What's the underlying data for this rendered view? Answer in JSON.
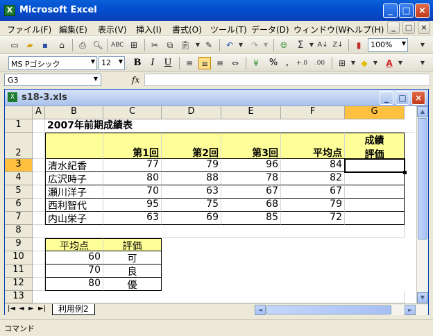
{
  "window": {
    "title": "Microsoft Excel",
    "minimize": "_",
    "maximize": "□",
    "close": "×"
  },
  "menu": [
    "ファイル(F)",
    "編集(E)",
    "表示(V)",
    "挿入(I)",
    "書式(O)",
    "ツール(T)",
    "データ(D)",
    "ウィンドウ(W)",
    "ヘルプ(H)"
  ],
  "toolbar": {
    "zoom": "100%",
    "font_name": "MS Pゴシック",
    "font_size": "12",
    "bold": "B",
    "italic": "I",
    "underline": "U",
    "percent": "%",
    "comma": ",",
    "fx": "fx"
  },
  "formula": {
    "namebox": "G3",
    "content": ""
  },
  "doc": {
    "title": "s18-3.xls"
  },
  "columns": [
    "A",
    "B",
    "C",
    "D",
    "E",
    "F",
    "G"
  ],
  "rows": [
    "1",
    "2",
    "3",
    "4",
    "5",
    "6",
    "7",
    "8",
    "9",
    "10",
    "11",
    "12",
    "13"
  ],
  "sheet": {
    "title": "2007年前期成績表",
    "headers": {
      "c": "第1回",
      "d": "第2回",
      "e": "第3回",
      "f": "平均点",
      "g1": "成績",
      "g2": "評価"
    },
    "students": [
      {
        "name": "清水紀香",
        "c": "77",
        "d": "79",
        "e": "96",
        "f": "84"
      },
      {
        "name": "広沢時子",
        "c": "80",
        "d": "88",
        "e": "78",
        "f": "82"
      },
      {
        "name": "瀬川洋子",
        "c": "70",
        "d": "63",
        "e": "67",
        "f": "67"
      },
      {
        "name": "西利智代",
        "c": "95",
        "d": "75",
        "e": "68",
        "f": "79"
      },
      {
        "name": "内山栄子",
        "c": "63",
        "d": "69",
        "e": "85",
        "f": "72"
      }
    ],
    "lookup_header": {
      "b": "平均点",
      "c": "評価"
    },
    "lookup": [
      {
        "b": "60",
        "c": "可"
      },
      {
        "b": "70",
        "c": "良"
      },
      {
        "b": "80",
        "c": "優"
      }
    ]
  },
  "sheet_tab": "利用例2",
  "tab_nav": [
    "|◄",
    "◄",
    "►",
    "►|"
  ],
  "status": "コマンド"
}
